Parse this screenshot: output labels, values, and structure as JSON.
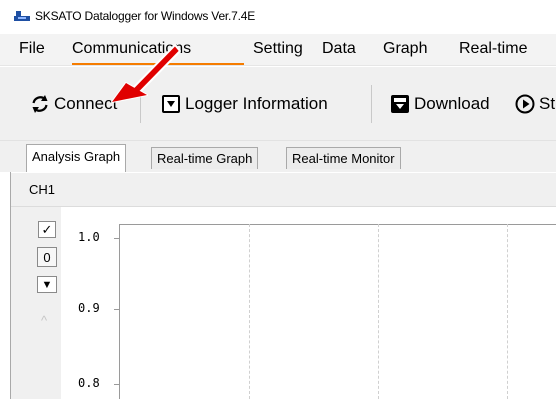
{
  "window": {
    "title": "SKSATO Datalogger for Windows  Ver.7.4E",
    "icon": "datalogger-app-icon"
  },
  "menu": {
    "items": [
      "File",
      "Communications",
      "Setting",
      "Data",
      "Graph",
      "Real-time"
    ],
    "active_index": 1,
    "accent_color": "#f57c00"
  },
  "toolbar": {
    "connect_label": "Connect",
    "logger_info_label": "Logger Information",
    "download_label": "Download",
    "start_label": "St",
    "icons": [
      "refresh-icon",
      "logger-download-icon",
      "inbox-download-icon",
      "play-circle-icon"
    ]
  },
  "tabs": [
    {
      "label": "Analysis Graph",
      "active": true
    },
    {
      "label": "Real-time Graph",
      "active": false
    },
    {
      "label": "Real-time Monitor",
      "active": false
    }
  ],
  "channel": {
    "label": "CH1",
    "checkbox_checked": true,
    "checkbox_symbol": "✓",
    "offset_value": "0",
    "dropdown_symbol": "▼",
    "scroll_up_symbol": "^"
  },
  "graph": {
    "y_ticks": [
      "1.0",
      "0.9",
      "0.8"
    ]
  },
  "annotation": {
    "arrow_color": "#e00000",
    "arrow_target": "connect-button"
  }
}
